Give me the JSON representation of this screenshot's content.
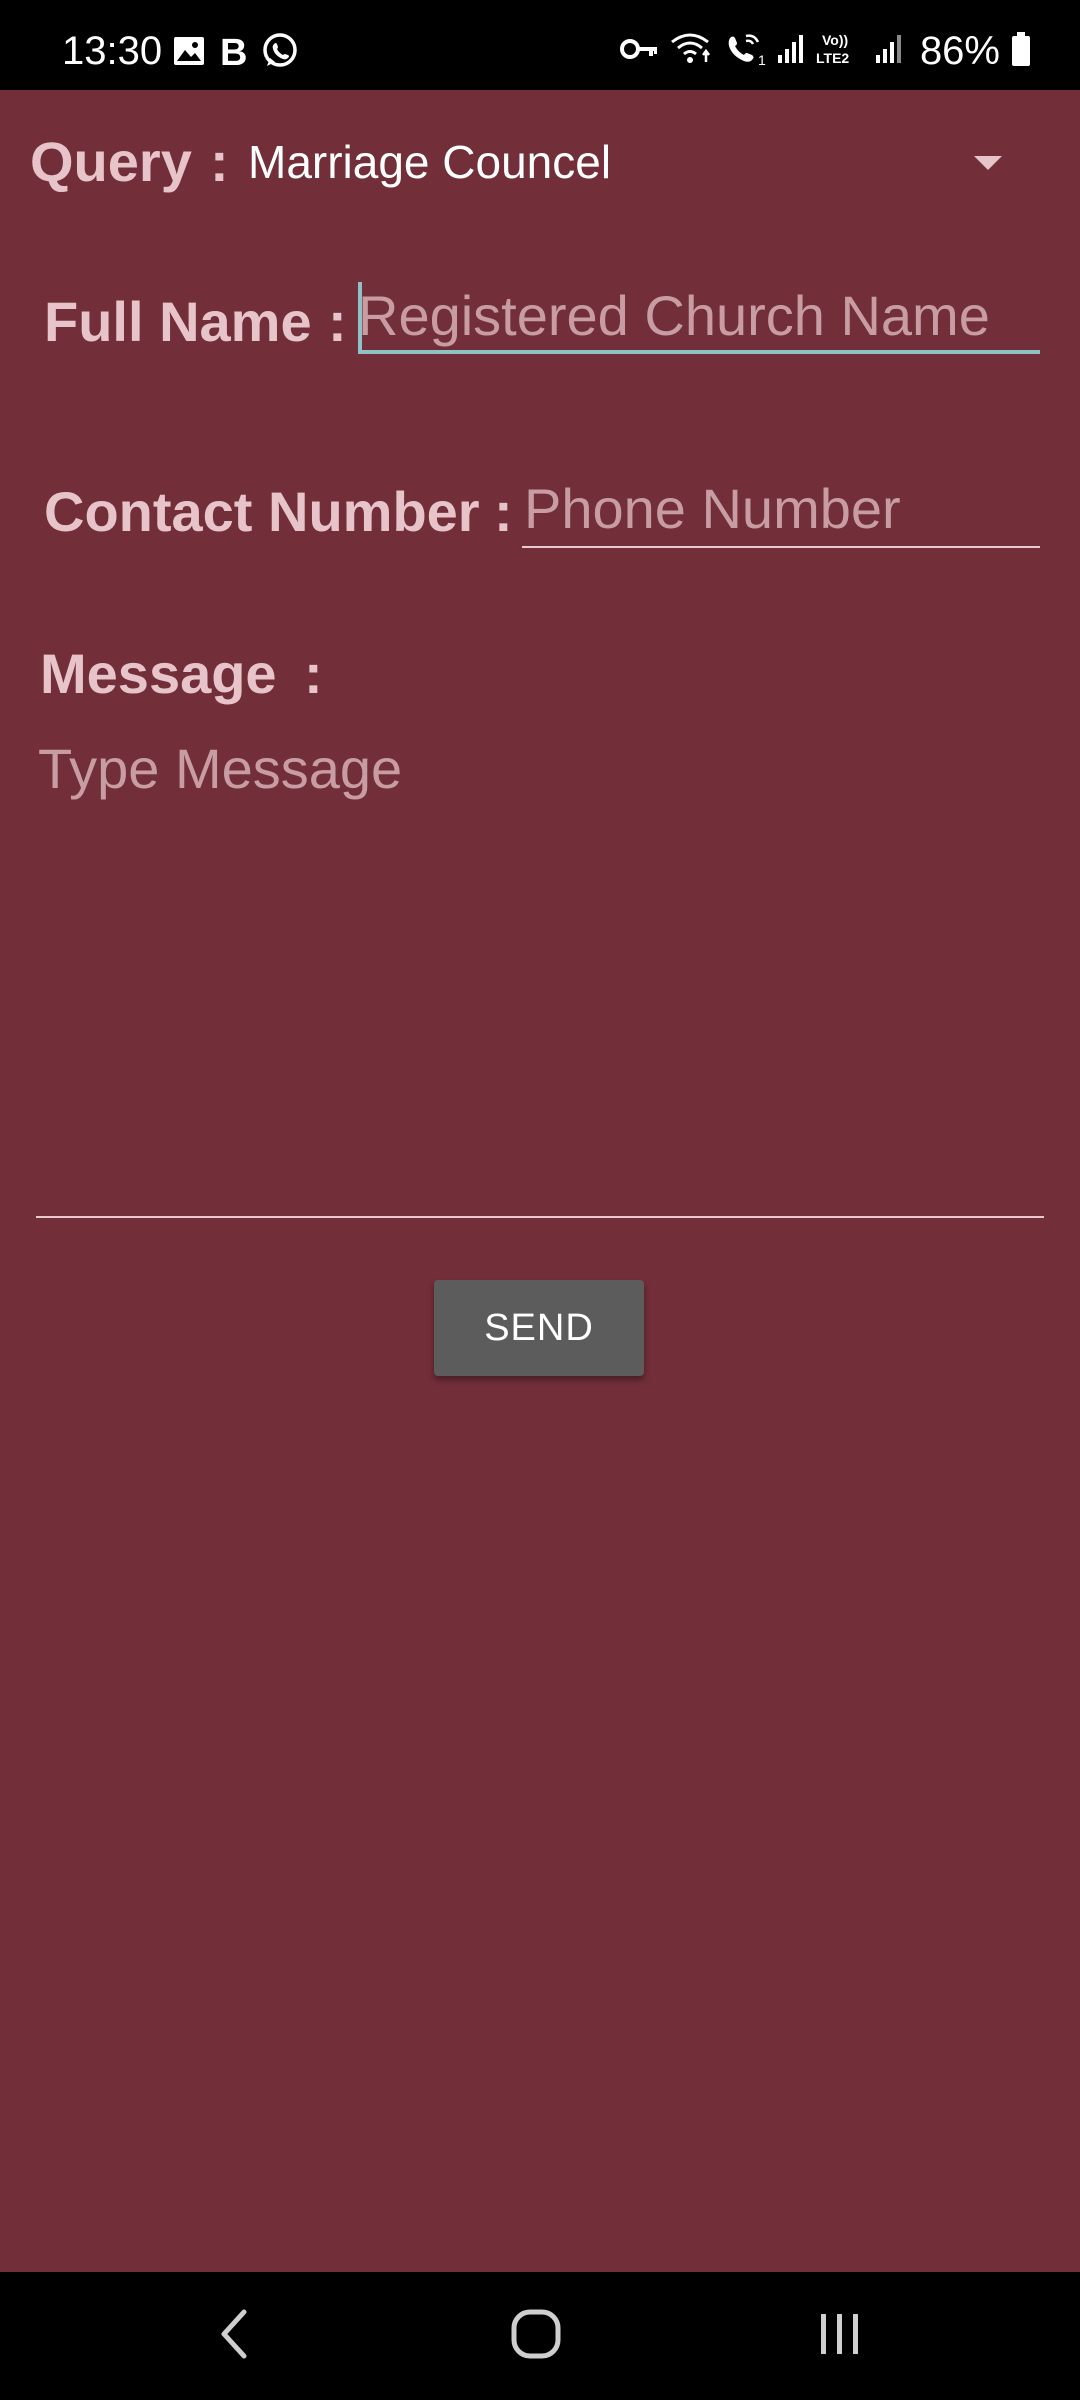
{
  "status_bar": {
    "time": "13:30",
    "left_icons": [
      "gallery-icon",
      "b-app-icon",
      "whatsapp-icon"
    ],
    "b_glyph": "B",
    "right_icons": [
      "vpn-key-icon",
      "wifi-icon",
      "wifi-calling-icon",
      "signal-icon",
      "volte-lte2-icon",
      "signal-2-icon",
      "battery-icon"
    ],
    "battery": "86%"
  },
  "form": {
    "query": {
      "label": "Query",
      "colon": ":",
      "value": "Marriage Councel"
    },
    "full_name": {
      "label": "Full Name",
      "colon": ":",
      "placeholder": "Registered Church Name",
      "value": ""
    },
    "contact": {
      "label": "Contact Number",
      "colon": ":",
      "placeholder": "Phone Number",
      "value": ""
    },
    "message": {
      "label": "Message",
      "colon": ":",
      "placeholder": "Type Message",
      "value": ""
    },
    "send_label": "SEND"
  },
  "nav_bar": {
    "buttons": [
      "back-icon",
      "home-icon",
      "recents-icon"
    ]
  },
  "colors": {
    "background": "#722e39",
    "label": "#e7c4c9",
    "placeholder": "#c79da3",
    "focus_accent": "#8fc1c7",
    "button": "#5c5c5c"
  }
}
